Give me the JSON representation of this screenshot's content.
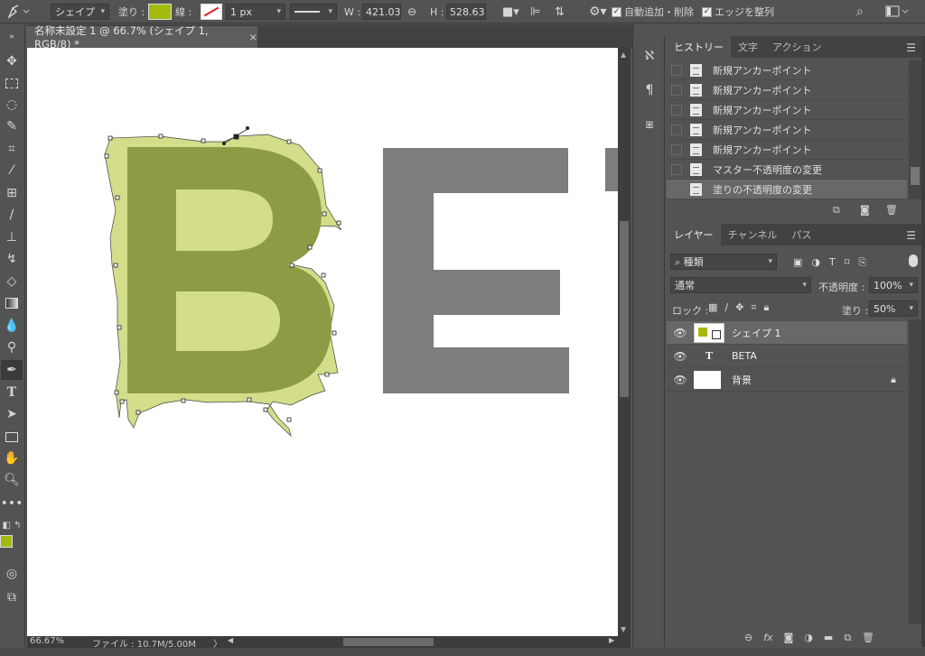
{
  "options_bar": {
    "tool_icon": "pen-icon",
    "mode": "シェイプ",
    "fill_label": "塗り :",
    "fill_color": "#a5b90f",
    "stroke_label": "線 :",
    "stroke_width": "1 px",
    "w_label": "W :",
    "w_value": "421.03 p",
    "h_label": "H :",
    "h_value": "528.63 p",
    "auto_add_delete": "自動追加・削除",
    "align_edges": "エッジを整列"
  },
  "document": {
    "tab_title": "名称未設定 1 @ 66.7% (シェイプ 1, RGB/8) *",
    "close": "×",
    "canvas_text": "BET",
    "shape_color": "#d3dd8a",
    "letter_b_color": "#8d9b45",
    "text_color": "#7d7d7d"
  },
  "status": {
    "zoom": "66.67%",
    "file_info": "ファイル : 10.7M/5.00M",
    "arrow": "〉"
  },
  "history_panel": {
    "tabs": [
      "ヒストリー",
      "文字",
      "アクション"
    ],
    "items": [
      "新規アンカーポイント",
      "新規アンカーポイント",
      "新規アンカーポイント",
      "新規アンカーポイント",
      "新規アンカーポイント",
      "マスター不透明度の変更",
      "塗りの不透明度の変更"
    ]
  },
  "layers_panel": {
    "tabs": [
      "レイヤー",
      "チャンネル",
      "パス"
    ],
    "filter_kind": "種類",
    "blend_mode": "通常",
    "opacity_label": "不透明度 :",
    "opacity_value": "100%",
    "lock_label": "ロック :",
    "fill_label": "塗り :",
    "fill_value": "50%",
    "layers": [
      {
        "name": "シェイプ 1",
        "type": "shape"
      },
      {
        "name": "BETA",
        "type": "text"
      },
      {
        "name": "背景",
        "type": "background"
      }
    ]
  }
}
